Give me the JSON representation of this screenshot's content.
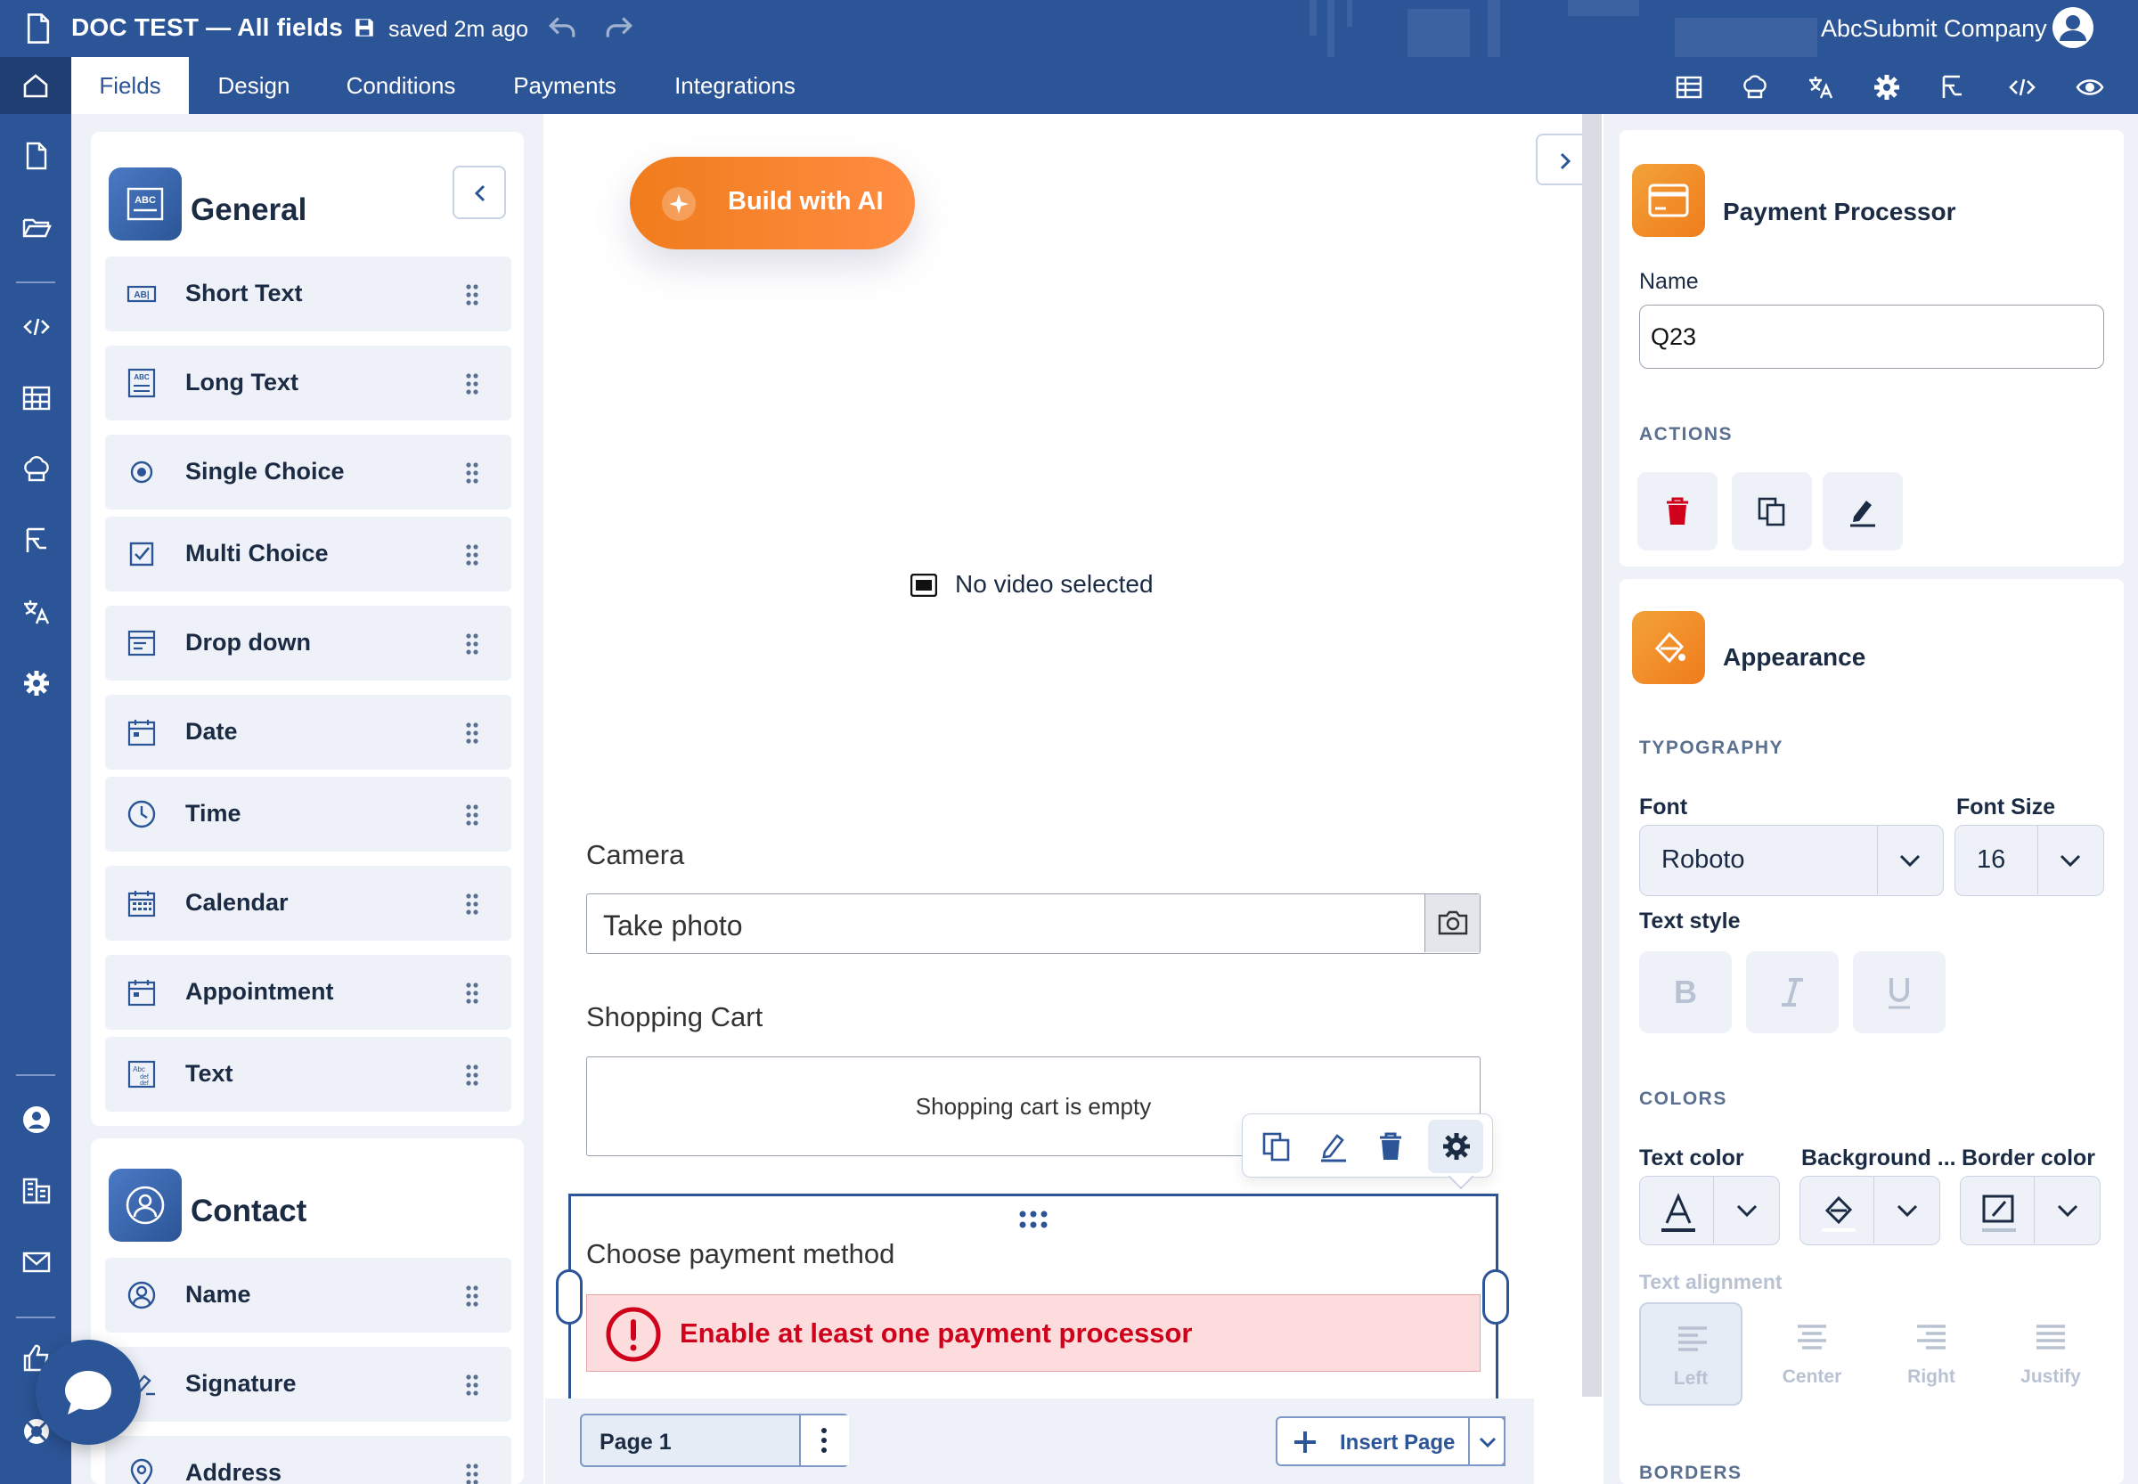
{
  "header": {
    "title": "DOC TEST — All fields",
    "saved_status": "saved 2m ago",
    "company": "AbcSubmit Company"
  },
  "nav": {
    "tabs": [
      {
        "label": "Fields",
        "active": true
      },
      {
        "label": "Design",
        "active": false
      },
      {
        "label": "Conditions",
        "active": false
      },
      {
        "label": "Payments",
        "active": false
      },
      {
        "label": "Integrations",
        "active": false
      }
    ],
    "tool_icons": [
      "table-icon",
      "chef-hat-icon",
      "translate-icon",
      "gear-icon",
      "flow-icon",
      "code-icon",
      "eye-icon"
    ]
  },
  "rail": {
    "icons": [
      "document-icon",
      "folder-open-icon",
      "code-icon",
      "table-icon",
      "chef-hat-icon",
      "flow-icon",
      "translate-icon",
      "gear-icon",
      "user-circle-icon",
      "building-icon",
      "mail-icon",
      "thumb-up-icon",
      "lifebuoy-icon"
    ]
  },
  "palette": {
    "general": {
      "title": "General",
      "items": [
        {
          "label": "Short Text",
          "icon": "short-text-icon"
        },
        {
          "label": "Long Text",
          "icon": "long-text-icon"
        },
        {
          "label": "Single Choice",
          "icon": "radio-icon"
        },
        {
          "label": "Multi Choice",
          "icon": "checkbox-icon"
        },
        {
          "label": "Drop down",
          "icon": "dropdown-icon"
        },
        {
          "label": "Date",
          "icon": "date-icon"
        },
        {
          "label": "Time",
          "icon": "clock-icon"
        },
        {
          "label": "Calendar",
          "icon": "calendar-icon"
        },
        {
          "label": "Appointment",
          "icon": "appointment-icon"
        },
        {
          "label": "Text",
          "icon": "text-icon"
        }
      ]
    },
    "contact": {
      "title": "Contact",
      "items": [
        {
          "label": "Name",
          "icon": "user-icon"
        },
        {
          "label": "Signature",
          "icon": "signature-icon"
        },
        {
          "label": "Address",
          "icon": "location-icon"
        }
      ]
    }
  },
  "canvas": {
    "ai_button": "Build with AI",
    "video_placeholder": "No video selected",
    "camera_label": "Camera",
    "camera_placeholder": "Take photo",
    "cart_label": "Shopping Cart",
    "cart_empty": "Shopping cart is empty",
    "payment_label": "Choose payment method",
    "payment_error": "Enable at least one payment processor",
    "page_tab": "Page 1",
    "insert_page": "Insert Page"
  },
  "props": {
    "processor_title": "Payment Processor",
    "name_label": "Name",
    "name_value": "Q23",
    "actions_label": "ACTIONS",
    "appearance_title": "Appearance",
    "typography_label": "TYPOGRAPHY",
    "font_label": "Font",
    "font_value": "Roboto",
    "font_size_label": "Font Size",
    "font_size_value": "16",
    "text_style_label": "Text style",
    "colors_label": "COLORS",
    "text_color_label": "Text color",
    "background_label": "Background ...",
    "border_color_label": "Border color",
    "text_alignment_label": "Text alignment",
    "alignments": [
      "Left",
      "Center",
      "Right",
      "Justify"
    ],
    "borders_label": "BORDERS"
  },
  "colors": {
    "brand": "#2c5597",
    "accent_orange": "#f07c1c",
    "error_red": "#d0021b",
    "error_bg": "#fcdcdc"
  }
}
